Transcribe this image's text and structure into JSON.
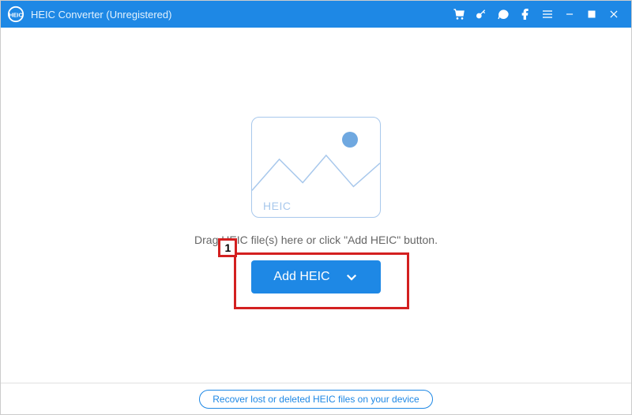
{
  "titlebar": {
    "app_title": "HEIC Converter (Unregistered)"
  },
  "main": {
    "placeholder_label": "HEIC",
    "instruction": "Drag HEIC file(s) here or click \"Add HEIC\" button.",
    "add_button_label": "Add HEIC"
  },
  "annotation": {
    "step_number": "1"
  },
  "footer": {
    "recover_link": "Recover lost or deleted HEIC files on your device"
  },
  "colors": {
    "primary": "#1e88e5",
    "annotation": "#d32020"
  }
}
